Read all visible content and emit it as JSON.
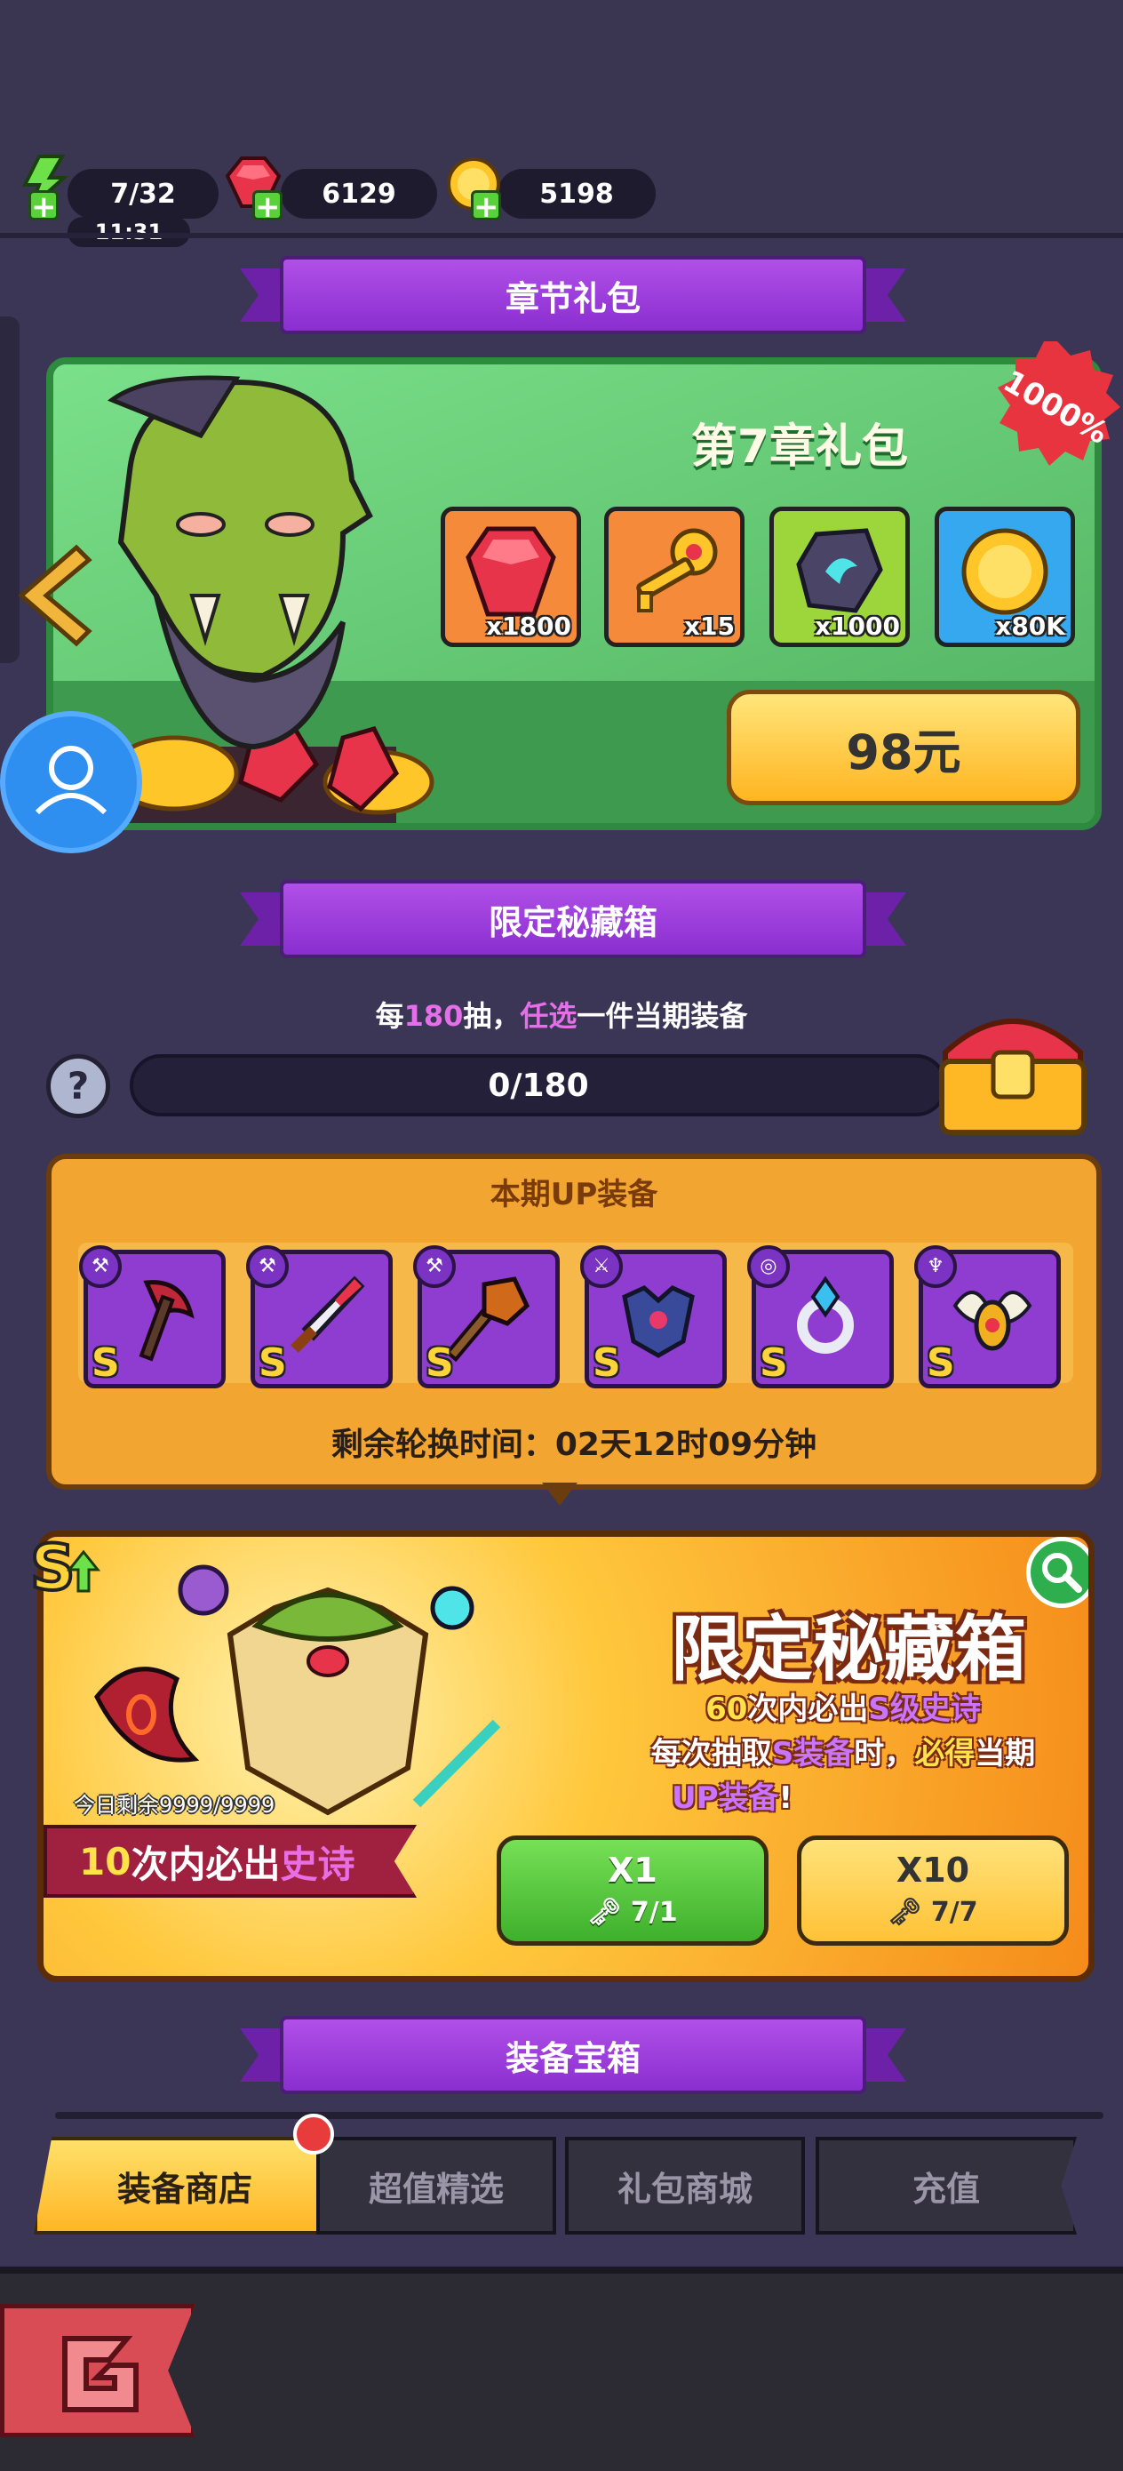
{
  "resources": {
    "stamina": "7/32",
    "stamina_timer": "11:31",
    "gems": "6129",
    "coins": "5198"
  },
  "chapter_pack": {
    "section_title": "章节礼包",
    "title": "第7章礼包",
    "badge": "1000%",
    "items": [
      {
        "icon": "ruby-gem-icon",
        "qty": "x1800",
        "bg": "#f58a3a"
      },
      {
        "icon": "golden-key-icon",
        "qty": "x15",
        "bg": "#f58a3a"
      },
      {
        "icon": "dark-stone-icon",
        "qty": "x1000",
        "bg": "#9cd63a"
      },
      {
        "icon": "gold-coin-icon",
        "qty": "x80K",
        "bg": "#35a8f0"
      }
    ],
    "price": "98元"
  },
  "limited_box": {
    "section_title": "限定秘藏箱",
    "info_pre": "每",
    "info_num": "180",
    "info_mid": "抽，",
    "info_hl": "任选",
    "info_post": "一件当期装备",
    "progress_text": "0/180",
    "progress_fraction": 0,
    "up_title": "本期UP装备",
    "rotation_time": "剩余轮换时间：02天12时09分钟",
    "equipment_grade": "S"
  },
  "banner": {
    "title": "限定秘藏箱",
    "line1_num": "60",
    "line1_mid": "次内必出",
    "line1_hl": "S级史诗",
    "line2_pre": "每次抽取",
    "line2_hl": "S装备",
    "line2_mid": "时，",
    "line2_hl2": "必得",
    "line2_post": "当期",
    "line3_hl": "UP装备",
    "line3_post": "!",
    "today_left": "今日剩余9999/9999",
    "flag_num": "10",
    "flag_mid": "次内必出",
    "flag_hl": "史诗",
    "x1_label": "X1",
    "x1_cost": "7/1",
    "x10_label": "X10",
    "x10_cost": "7/7"
  },
  "equipment_box": {
    "section_title": "装备宝箱"
  },
  "tabs": [
    {
      "label": "装备商店",
      "active": true
    },
    {
      "label": "超值精选",
      "active": false
    },
    {
      "label": "礼包商城",
      "active": false
    },
    {
      "label": "充值",
      "active": false
    }
  ],
  "colors": {
    "background": "#3b3556",
    "ribbon": "#9a3ce0",
    "pack_green": "#5fc56d",
    "price_button": "#ffc236",
    "up_panel": "#f2a531"
  }
}
